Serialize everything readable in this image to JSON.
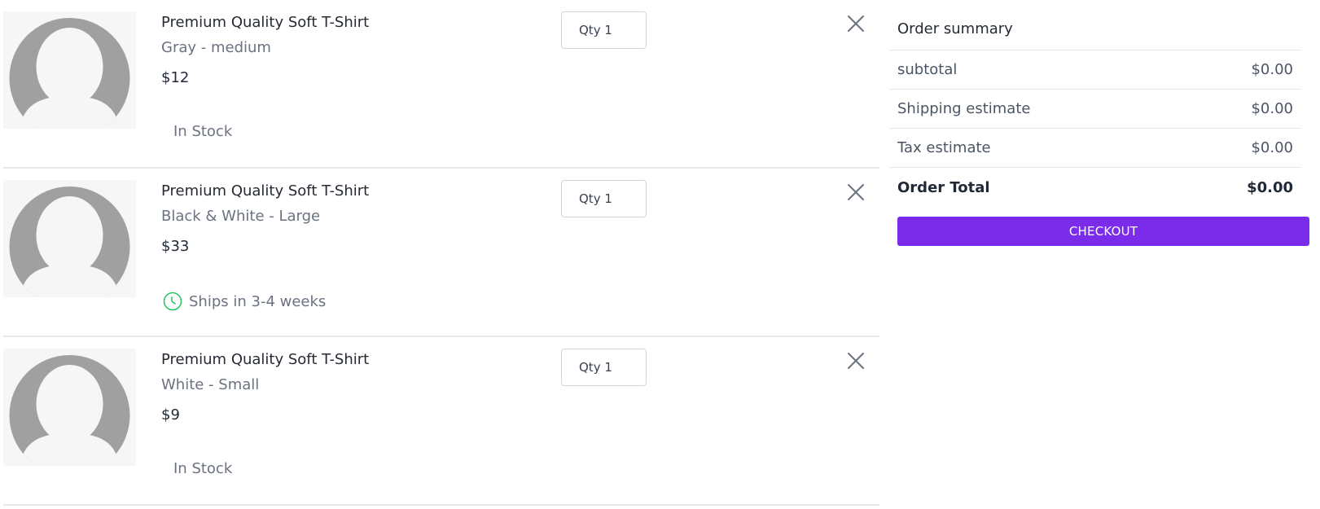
{
  "cart": {
    "items": [
      {
        "title": "Premium Quality Soft T-Shirt",
        "variant": "Gray - medium",
        "price": "$12",
        "qty_label": "Qty 1",
        "stock_text": "In Stock",
        "stock_icon": ""
      },
      {
        "title": "Premium Quality Soft T-Shirt",
        "variant": "Black & White - Large",
        "price": "$33",
        "qty_label": "Qty 1",
        "stock_text": "Ships in 3-4 weeks",
        "stock_icon": "clock-icon"
      },
      {
        "title": "Premium Quality Soft T-Shirt",
        "variant": "White - Small",
        "price": "$9",
        "qty_label": "Qty 1",
        "stock_text": "In Stock",
        "stock_icon": ""
      }
    ]
  },
  "summary": {
    "title": "Order summary",
    "rows": [
      {
        "label": "subtotal",
        "value": "$0.00"
      },
      {
        "label": "Shipping estimate",
        "value": "$0.00"
      },
      {
        "label": "Tax estimate",
        "value": "$0.00"
      }
    ],
    "total": {
      "label": "Order Total",
      "value": "$0.00"
    },
    "checkout_label": "CHECKOUT"
  },
  "colors": {
    "accent": "#7b2ceb",
    "clock": "#22c55e",
    "placeholder": "#a0a0a0"
  }
}
